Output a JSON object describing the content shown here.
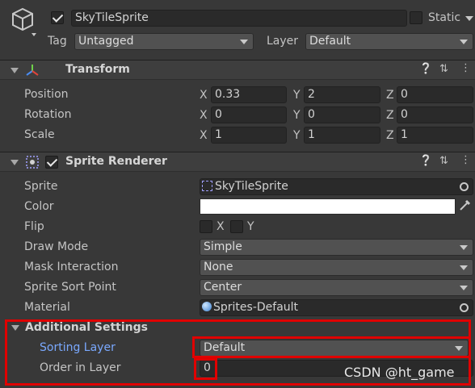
{
  "object": {
    "active": true,
    "name": "SkyTileSprite",
    "static_label": "Static",
    "static_checked": false,
    "tag_label": "Tag",
    "tag_value": "Untagged",
    "layer_label": "Layer",
    "layer_value": "Default"
  },
  "transform": {
    "title": "Transform",
    "rows": [
      {
        "label": "Position",
        "x": "0.33",
        "y": "2",
        "z": "0"
      },
      {
        "label": "Rotation",
        "x": "0",
        "y": "0",
        "z": "0"
      },
      {
        "label": "Scale",
        "x": "1",
        "y": "1",
        "z": "1"
      }
    ],
    "axes": {
      "x": "X",
      "y": "Y",
      "z": "Z"
    }
  },
  "sprite_renderer": {
    "title": "Sprite Renderer",
    "enabled": true,
    "sprite_label": "Sprite",
    "sprite_value": "SkyTileSprite",
    "color_label": "Color",
    "color_value": "#ffffff",
    "flip_label": "Flip",
    "flip_x_label": "X",
    "flip_y_label": "Y",
    "draw_mode_label": "Draw Mode",
    "draw_mode_value": "Simple",
    "mask_label": "Mask Interaction",
    "mask_value": "None",
    "sort_point_label": "Sprite Sort Point",
    "sort_point_value": "Center",
    "material_label": "Material",
    "material_value": "Sprites-Default"
  },
  "additional_settings": {
    "title": "Additional Settings",
    "sorting_layer_label": "Sorting Layer",
    "sorting_layer_value": "Default",
    "order_label": "Order in Layer",
    "order_value": "0"
  },
  "watermark": "CSDN @ht_game"
}
